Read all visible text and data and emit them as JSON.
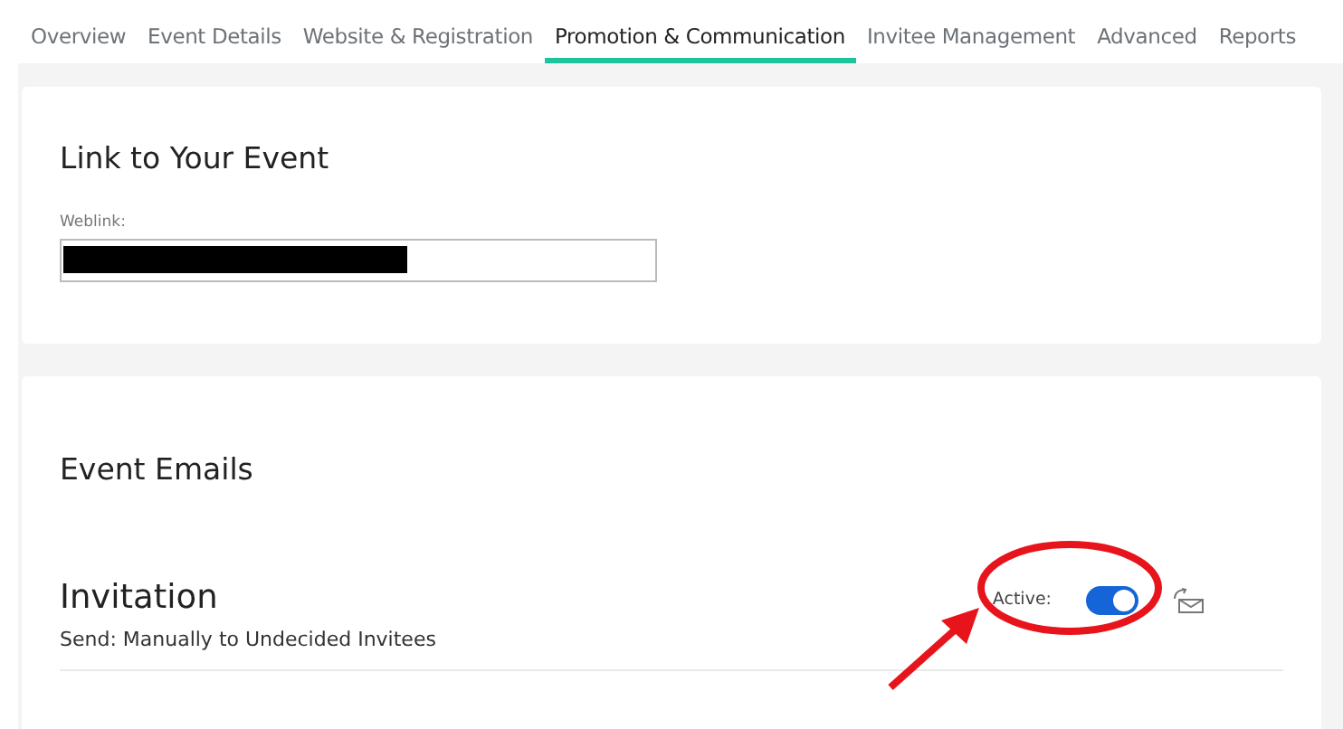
{
  "tabs": [
    {
      "label": "Overview",
      "selected": false
    },
    {
      "label": "Event Details",
      "selected": false
    },
    {
      "label": "Website & Registration",
      "selected": false
    },
    {
      "label": "Promotion & Communication",
      "selected": true
    },
    {
      "label": "Invitee Management",
      "selected": false
    },
    {
      "label": "Advanced",
      "selected": false
    },
    {
      "label": "Reports",
      "selected": false
    }
  ],
  "link_card": {
    "title": "Link to Your Event",
    "weblink": {
      "label": "Weblink:",
      "redacted": true
    }
  },
  "emails_card": {
    "title": "Event Emails",
    "emails": [
      {
        "name": "Invitation",
        "send": "Send: Manually to Undecided Invitees",
        "active_label": "Active:",
        "on": true,
        "annotated": true
      }
    ]
  }
}
